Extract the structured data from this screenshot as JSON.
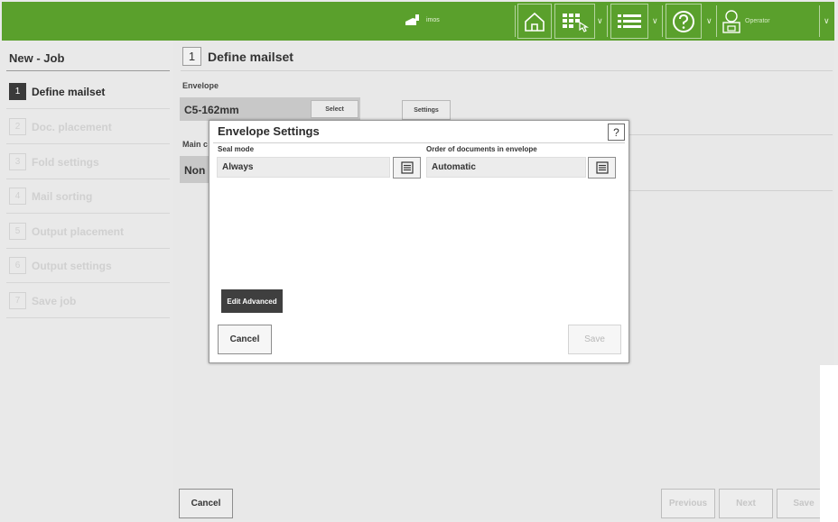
{
  "topbar": {
    "brand": "imos",
    "operator": "Operator",
    "icons": [
      "home-icon",
      "grid-hand-icon",
      "chevron-down-icon",
      "list-icon",
      "chevron-down-icon",
      "help-circle-icon",
      "chevron-down-icon",
      "operator-icon",
      "chevron-down-icon"
    ]
  },
  "sidebar": {
    "title": "New - Job",
    "steps": [
      {
        "num": "1",
        "label": "Define mailset"
      },
      {
        "num": "2",
        "label": "Doc. placement"
      },
      {
        "num": "3",
        "label": "Fold settings"
      },
      {
        "num": "4",
        "label": "Mail sorting"
      },
      {
        "num": "5",
        "label": "Output placement"
      },
      {
        "num": "6",
        "label": "Output settings"
      },
      {
        "num": "7",
        "label": "Save job"
      }
    ]
  },
  "main": {
    "step_num": "1",
    "title": "Define mailset",
    "envelope_label": "Envelope",
    "envelope_value": "C5-162mm",
    "select_label": "Select",
    "settings_label": "Settings",
    "main_label": "Main c",
    "main_value": "Non"
  },
  "footer": {
    "cancel": "Cancel",
    "previous": "Previous",
    "next": "Next",
    "save": "Save"
  },
  "modal": {
    "title": "Envelope Settings",
    "help": "?",
    "seal_label": "Seal mode",
    "seal_value": "Always",
    "order_label": "Order of documents in envelope",
    "order_value": "Automatic",
    "edit_advanced": "Edit Advanced",
    "cancel": "Cancel",
    "save": "Save"
  },
  "colors": {
    "topbar": "#5aa02c",
    "active_step": "#3a3a3a",
    "disabled_text": "#d0d0d0"
  }
}
